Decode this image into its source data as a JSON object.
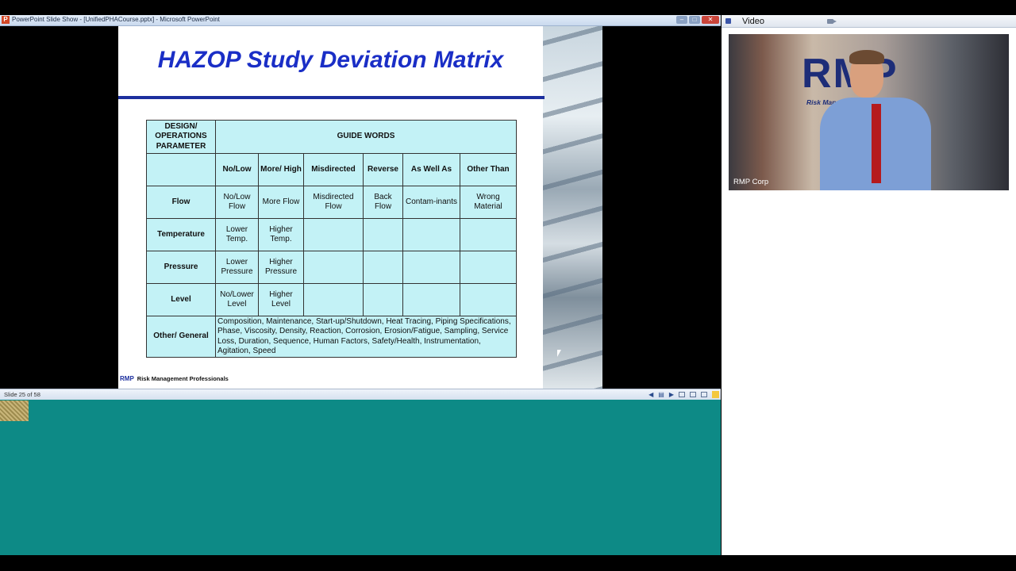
{
  "window": {
    "title": "PowerPoint Slide Show - [UnifiedPHACourse.pptx] - Microsoft PowerPoint",
    "app_icon": "P",
    "minimize_icon": "–",
    "maximize_icon": "□",
    "close_icon": "✕"
  },
  "slide": {
    "title": "HAZOP Study Deviation Matrix",
    "table": {
      "param_header": "DESIGN/ OPERATIONS PARAMETER",
      "guide_words_header": "GUIDE WORDS",
      "guide_words": [
        "No/Low",
        "More/ High",
        "Misdirected",
        "Reverse",
        "As Well As",
        "Other Than"
      ],
      "rows": [
        {
          "param": "Flow",
          "cells": [
            "No/Low Flow",
            "More Flow",
            "Misdirected Flow",
            "Back Flow",
            "Contam-inants",
            "Wrong Material"
          ]
        },
        {
          "param": "Temperature",
          "cells": [
            "Lower Temp.",
            "Higher Temp.",
            "",
            "",
            "",
            ""
          ]
        },
        {
          "param": "Pressure",
          "cells": [
            "Lower Pressure",
            "Higher Pressure",
            "",
            "",
            "",
            ""
          ]
        },
        {
          "param": "Level",
          "cells": [
            "No/Lower Level",
            "Higher Level",
            "",
            "",
            "",
            ""
          ]
        }
      ],
      "general_row": {
        "param": "Other/ General",
        "text": "Composition, Maintenance, Start-up/Shutdown, Heat Tracing, Piping Specifications, Phase, Viscosity, Density, Reaction, Corrosion, Erosion/Fatigue, Sampling, Service Loss, Duration, Sequence, Human Factors, Safety/Health, Instrumentation, Agitation, Speed"
      }
    },
    "footer_logo": "RMP",
    "footer_text": "Risk Management Professionals"
  },
  "statusbar": {
    "slide_count": "Slide 25 of 58"
  },
  "video": {
    "panel_title": "Video",
    "logo_text": "RMP",
    "logo_subtitle": "Risk Management Professionals",
    "caption": "RMP Corp"
  }
}
